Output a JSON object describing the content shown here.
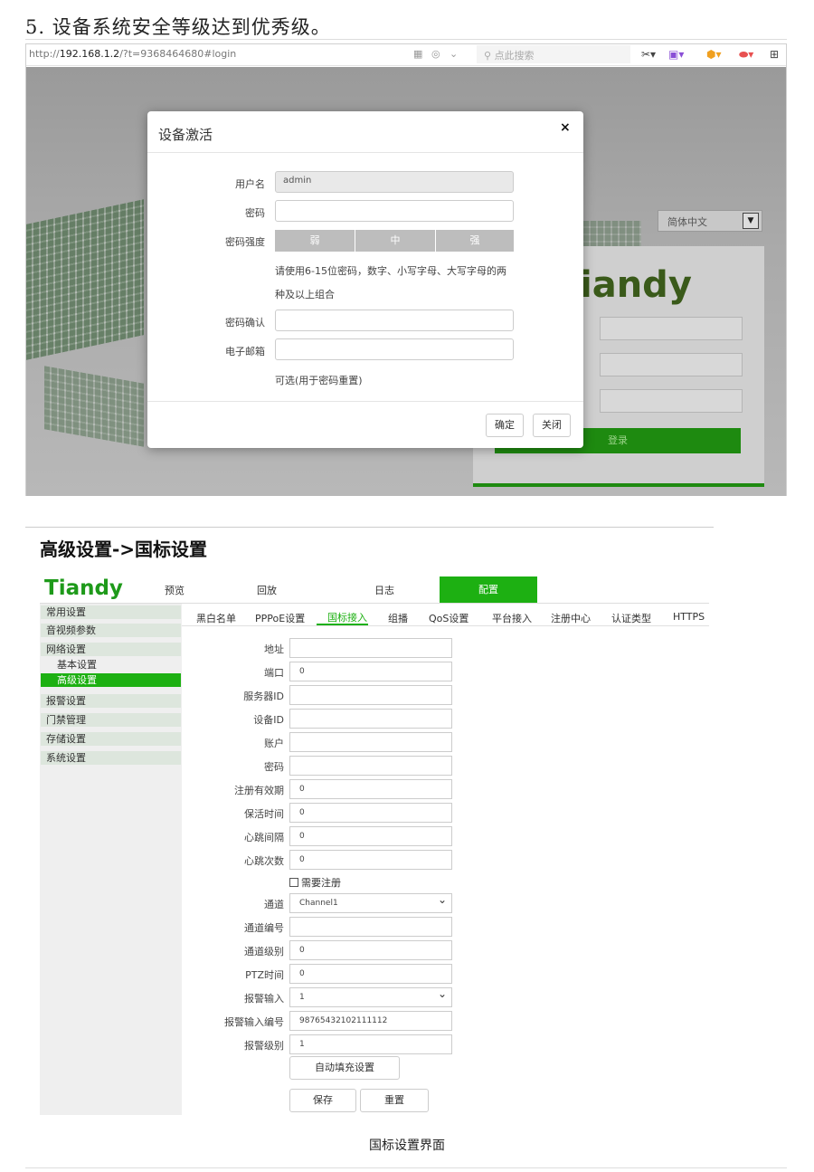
{
  "doc": {
    "heading": "5. 设备系统安全等级达到优秀级。",
    "section_title": "高级设置->国标设置",
    "caption": "国标设置界面"
  },
  "browser": {
    "url_prefix": "http://",
    "url_host": "192.168.1.2",
    "url_rest": "/?t=9368464680#login",
    "search_placeholder": "点此搜索"
  },
  "login_page": {
    "language": "简体中文",
    "brand": "iandy",
    "login_button": "登录"
  },
  "modal": {
    "title": "设备激活",
    "close": "×",
    "username_label": "用户名",
    "username_value": "admin",
    "password_label": "密码",
    "strength_label": "密码强度",
    "strength_levels": [
      "弱",
      "中",
      "强"
    ],
    "hint_line1": "请使用6-15位密码，数字、小写字母、大写字母的两",
    "hint_line2": "种及以上组合",
    "confirm_label": "密码确认",
    "email_label": "电子邮箱",
    "email_hint": "可选(用于密码重置)",
    "ok_button": "确定",
    "close_button": "关闭"
  },
  "app": {
    "logo": "Tiandy",
    "nav": [
      "预览",
      "回放",
      "日志",
      "配置"
    ],
    "sidebar": [
      "常用设置",
      "音视频参数",
      "网络设置",
      "基本设置",
      "高级设置",
      "报警设置",
      "门禁管理",
      "存储设置",
      "系统设置"
    ],
    "tabs": [
      "黑白名单",
      "PPPoE设置",
      "国标接入",
      "组播",
      "QoS设置",
      "平台接入",
      "注册中心",
      "认证类型",
      "HTTPS"
    ],
    "fields": {
      "address": {
        "label": "地址",
        "value": ""
      },
      "port": {
        "label": "端口",
        "value": "0"
      },
      "server_id": {
        "label": "服务器ID",
        "value": ""
      },
      "device_id": {
        "label": "设备ID",
        "value": ""
      },
      "account": {
        "label": "账户",
        "value": ""
      },
      "password": {
        "label": "密码",
        "value": ""
      },
      "reg_validity": {
        "label": "注册有效期",
        "value": "0"
      },
      "keepalive": {
        "label": "保活时间",
        "value": "0"
      },
      "hb_interval": {
        "label": "心跳间隔",
        "value": "0"
      },
      "hb_count": {
        "label": "心跳次数",
        "value": "0"
      },
      "need_register": {
        "label": "需要注册",
        "checked": false
      },
      "channel": {
        "label": "通道",
        "value": "Channel1"
      },
      "channel_no": {
        "label": "通道编号",
        "value": ""
      },
      "channel_level": {
        "label": "通道级别",
        "value": "0"
      },
      "ptz_time": {
        "label": "PTZ时间",
        "value": "0"
      },
      "alarm_input": {
        "label": "报警输入",
        "value": "1"
      },
      "alarm_input_no": {
        "label": "报警输入编号",
        "value": "98765432102111112"
      },
      "alarm_level": {
        "label": "报警级别",
        "value": "1"
      }
    },
    "autofill_button": "自动填充设置",
    "save_button": "保存",
    "reset_button": "重置"
  }
}
